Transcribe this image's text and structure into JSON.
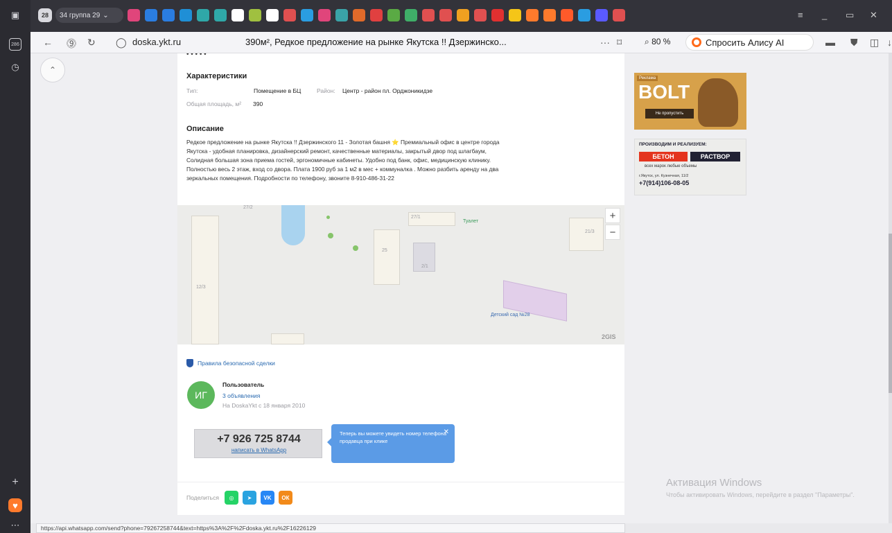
{
  "tabbar": {
    "tab_count": "28",
    "group_label": "34 группа 29",
    "favicon_colors": [
      "#e0457b",
      "#2a7de1",
      "#2a7de1",
      "#1f8fd6",
      "#2fa8a8",
      "#2fa8a8",
      "#ffffff",
      "#a0c040",
      "#ffffff",
      "#e05050",
      "#2a9de1",
      "#e0457b",
      "#3aa3a8",
      "#e06a2a",
      "#e04040",
      "#5aaa44",
      "#3fae68",
      "#e05050",
      "#e05050",
      "#f0a020",
      "#e05050",
      "#e03030",
      "#f5c518",
      "#ff7a2c",
      "#ff7a2c",
      "#ff5a2a",
      "#2a9de1",
      "#5a5aff",
      "#e05050"
    ]
  },
  "sidebar": {
    "tab_badge": "286"
  },
  "navbar": {
    "domain": "doska.ykt.ru",
    "title": "390м², Редкое предложение на рынке Якутска !! Дзержинско...",
    "menu_dots": "···",
    "zoom": "80 %",
    "alice": "Спросить Алису AI"
  },
  "listing": {
    "price_fragment": "• • • • •",
    "chars_heading": "Характеристики",
    "type_label": "Тип:",
    "type_value": "Помещение в БЦ",
    "district_label": "Район:",
    "district_value": "Центр - район пл. Орджоникидзе",
    "area_label": "Общая площадь, м²",
    "area_value": "390",
    "desc_heading": "Описание",
    "description": "Редкое предложение на рынке Якутска !! Дзержинского 11 - Золотая башня ⭐ Премиальный офис в центре города Якутска - удобная планировка, дизайнерский ремонт, качественные материалы, закрытый двор под шлагбаум, Солидная большая зона приема гостей, эргономичные кабинеты. Удобно под банк, офис, медицинскую клинику. Полностью весь 2 этаж, вход со двора. Плата 1900 руб за 1 м2 в мес + коммуналка . Можно разбить аренду на два зеркальных помещения. Подробности по телефону, звоните 8-910-486-31-22"
  },
  "map": {
    "labels": [
      "27/1",
      "Туалет",
      "21/3",
      "25",
      "2/1",
      "12/3",
      "27/2"
    ],
    "poi": "Детский сад №28",
    "brand": "2GIS",
    "zoom_in": "+",
    "zoom_out": "−"
  },
  "seller": {
    "safe_deal": "Правила безопасной сделки",
    "avatar_initials": "ИГ",
    "name": "Пользователь",
    "ads_count": "3 объявления",
    "since": "На DoskaYkt с 18 января 2010",
    "phone": "+7 926 725 8744",
    "whatsapp": "написать в WhatsApp",
    "tooltip": "Теперь вы можете увидеть номер телефона продавца при клике",
    "tooltip_close": "✕"
  },
  "share": {
    "label": "Поделиться",
    "buttons": [
      {
        "name": "whatsapp",
        "glyph": "◎",
        "color": "#25d366"
      },
      {
        "name": "telegram",
        "glyph": "➤",
        "color": "#2aa3e0"
      },
      {
        "name": "vk",
        "glyph": "VK",
        "color": "#2787f5"
      },
      {
        "name": "ok",
        "glyph": "ОК",
        "color": "#f28a1a"
      }
    ]
  },
  "ads": {
    "ad1_title": "BOLT",
    "ad1_badge": "Реклама",
    "ad1_button": "Не пропустить",
    "ad2_header": "ПРОИЗВОДИМ И РЕАЛИЗУЕМ:",
    "ad2_beton": "БЕТОН",
    "ad2_rastvor": "РАСТВОР",
    "ad2_line": "всех марок    любые объемы",
    "ad2_address": "г.Якутск, ул. Кузнечная, 11/2",
    "ad2_phone": "+7(914)106-08-05"
  },
  "watermark": {
    "title": "Активация Windows",
    "subtitle": "Чтобы активировать Windows, перейдите в раздел \"Параметры\"."
  },
  "statusbar": {
    "url": "https://api.whatsapp.com/send?phone=79267258744&text=https%3A%2F%2Fdoska.ykt.ru%2F16226129"
  }
}
